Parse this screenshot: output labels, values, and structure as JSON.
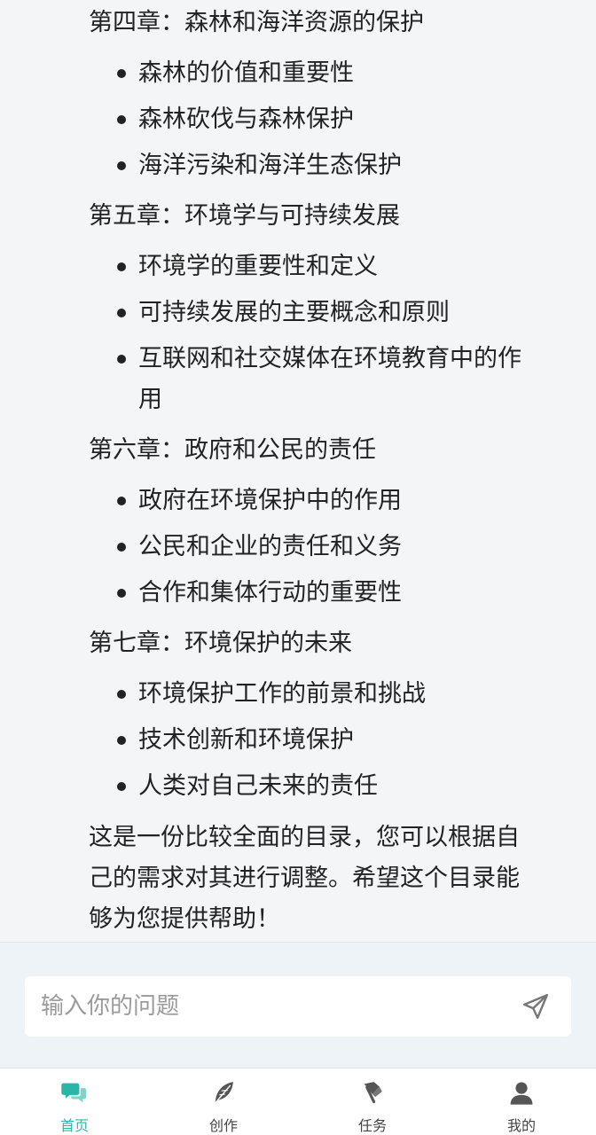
{
  "chapters": [
    {
      "title": "第四章：森林和海洋资源的保护",
      "items": [
        "森林的价值和重要性",
        "森林砍伐与森林保护",
        "海洋污染和海洋生态保护"
      ]
    },
    {
      "title": "第五章：环境学与可持续发展",
      "items": [
        "环境学的重要性和定义",
        "可持续发展的主要概念和原则",
        "互联网和社交媒体在环境教育中的作用"
      ]
    },
    {
      "title": "第六章：政府和公民的责任",
      "items": [
        "政府在环境保护中的作用",
        "公民和企业的责任和义务",
        "合作和集体行动的重要性"
      ]
    },
    {
      "title": "第七章：环境保护的未来",
      "items": [
        "环境保护工作的前景和挑战",
        "技术创新和环境保护",
        "人类对自己未来的责任"
      ]
    }
  ],
  "closing": "这是一份比较全面的目录，您可以根据自己的需求对其进行调整。希望这个目录能够为您提供帮助！",
  "input": {
    "placeholder": "输入你的问题",
    "value": ""
  },
  "tabs": [
    {
      "label": "首页",
      "icon": "chat-icon",
      "active": true
    },
    {
      "label": "创作",
      "icon": "feather-icon",
      "active": false
    },
    {
      "label": "任务",
      "icon": "flag-icon",
      "active": false
    },
    {
      "label": "我的",
      "icon": "user-icon",
      "active": false
    }
  ],
  "colors": {
    "accent": "#2bb5a8",
    "icon_gray": "#555555"
  }
}
